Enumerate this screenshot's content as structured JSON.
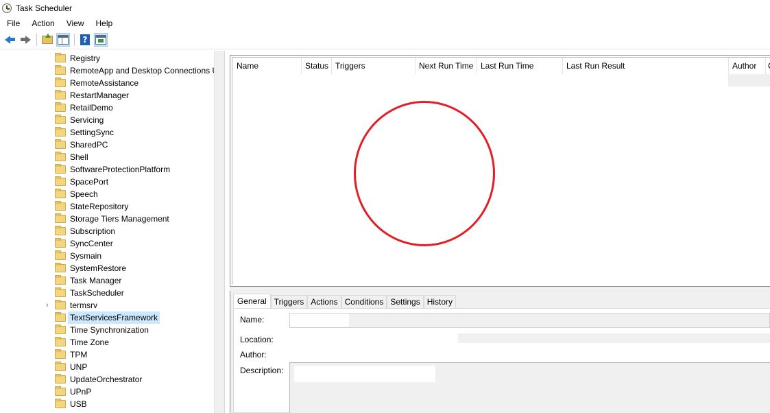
{
  "window": {
    "title": "Task Scheduler"
  },
  "menu": [
    "File",
    "Action",
    "View",
    "Help"
  ],
  "toolbar": {
    "buttons": [
      "back-icon",
      "forward-icon",
      "folder-up-icon",
      "show-hide-console-tree-icon",
      "help-icon",
      "show-hide-action-pane-icon"
    ]
  },
  "tree": {
    "items": [
      {
        "label": "Registry",
        "expandable": false,
        "selected": false
      },
      {
        "label": "RemoteApp and Desktop Connections Update",
        "expandable": false,
        "selected": false
      },
      {
        "label": "RemoteAssistance",
        "expandable": false,
        "selected": false
      },
      {
        "label": "RestartManager",
        "expandable": false,
        "selected": false
      },
      {
        "label": "RetailDemo",
        "expandable": false,
        "selected": false
      },
      {
        "label": "Servicing",
        "expandable": false,
        "selected": false
      },
      {
        "label": "SettingSync",
        "expandable": false,
        "selected": false
      },
      {
        "label": "SharedPC",
        "expandable": false,
        "selected": false
      },
      {
        "label": "Shell",
        "expandable": false,
        "selected": false
      },
      {
        "label": "SoftwareProtectionPlatform",
        "expandable": false,
        "selected": false
      },
      {
        "label": "SpacePort",
        "expandable": false,
        "selected": false
      },
      {
        "label": "Speech",
        "expandable": false,
        "selected": false
      },
      {
        "label": "StateRepository",
        "expandable": false,
        "selected": false
      },
      {
        "label": "Storage Tiers Management",
        "expandable": false,
        "selected": false
      },
      {
        "label": "Subscription",
        "expandable": false,
        "selected": false
      },
      {
        "label": "SyncCenter",
        "expandable": false,
        "selected": false
      },
      {
        "label": "Sysmain",
        "expandable": false,
        "selected": false
      },
      {
        "label": "SystemRestore",
        "expandable": false,
        "selected": false
      },
      {
        "label": "Task Manager",
        "expandable": false,
        "selected": false
      },
      {
        "label": "TaskScheduler",
        "expandable": false,
        "selected": false
      },
      {
        "label": "termsrv",
        "expandable": true,
        "selected": false
      },
      {
        "label": "TextServicesFramework",
        "expandable": false,
        "selected": true
      },
      {
        "label": "Time Synchronization",
        "expandable": false,
        "selected": false
      },
      {
        "label": "Time Zone",
        "expandable": false,
        "selected": false
      },
      {
        "label": "TPM",
        "expandable": false,
        "selected": false
      },
      {
        "label": "UNP",
        "expandable": false,
        "selected": false
      },
      {
        "label": "UpdateOrchestrator",
        "expandable": false,
        "selected": false
      },
      {
        "label": "UPnP",
        "expandable": false,
        "selected": false
      },
      {
        "label": "USB",
        "expandable": false,
        "selected": false
      }
    ]
  },
  "task_list": {
    "columns": [
      "Name",
      "Status",
      "Triggers",
      "Next Run Time",
      "Last Run Time",
      "Last Run Result",
      "Author",
      "C"
    ]
  },
  "details": {
    "tabs": [
      "General",
      "Triggers",
      "Actions",
      "Conditions",
      "Settings",
      "History"
    ],
    "active_tab": "General",
    "labels": {
      "name": "Name:",
      "location": "Location:",
      "author": "Author:",
      "description": "Description:"
    }
  },
  "annotation": {
    "color": "#e21f26"
  }
}
